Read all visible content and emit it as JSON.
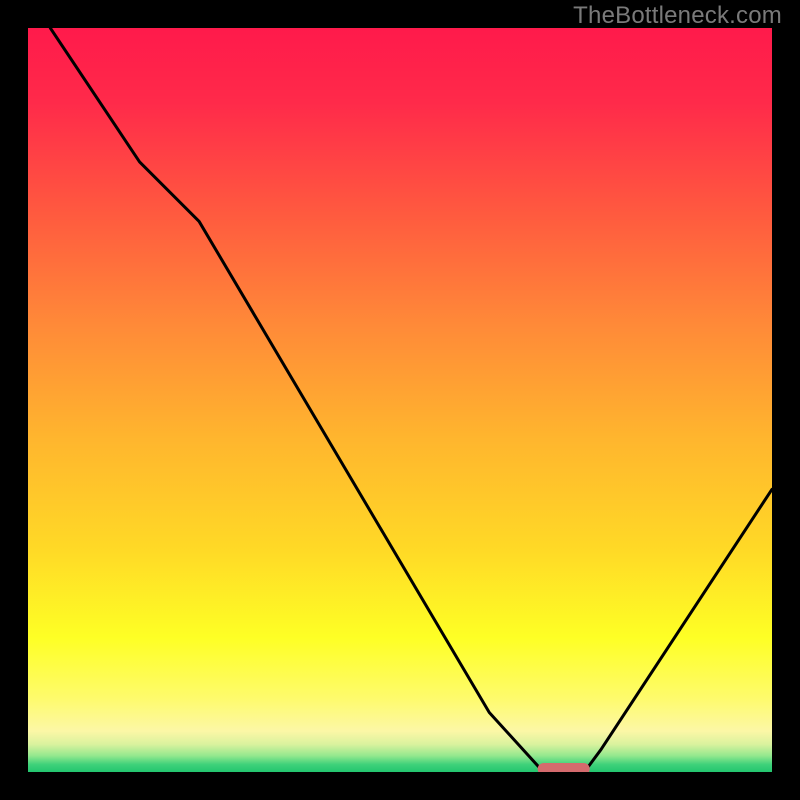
{
  "watermark": "TheBottleneck.com",
  "colors": {
    "gradient_stops": [
      {
        "offset": 0.0,
        "color": "#ff1a4b"
      },
      {
        "offset": 0.1,
        "color": "#ff2a4a"
      },
      {
        "offset": 0.25,
        "color": "#ff5a3f"
      },
      {
        "offset": 0.4,
        "color": "#ff8a38"
      },
      {
        "offset": 0.55,
        "color": "#ffb52e"
      },
      {
        "offset": 0.7,
        "color": "#ffd926"
      },
      {
        "offset": 0.82,
        "color": "#feff25"
      },
      {
        "offset": 0.9,
        "color": "#fefb6b"
      },
      {
        "offset": 0.945,
        "color": "#fcf7a6"
      },
      {
        "offset": 0.963,
        "color": "#d9f29e"
      },
      {
        "offset": 0.978,
        "color": "#94e88e"
      },
      {
        "offset": 0.99,
        "color": "#3ed17a"
      },
      {
        "offset": 1.0,
        "color": "#23c66f"
      }
    ],
    "curve": "#000000",
    "marker_fill": "#d46a6d",
    "background": "#000000"
  },
  "chart_data": {
    "type": "line",
    "title": "",
    "xlabel": "",
    "ylabel": "",
    "xlim": [
      0,
      100
    ],
    "ylim": [
      0,
      100
    ],
    "series": [
      {
        "name": "curve",
        "x": [
          3,
          15,
          23,
          62,
          69,
          75,
          77,
          100
        ],
        "values": [
          100,
          82,
          74,
          8,
          0.3,
          0.3,
          3,
          38
        ]
      }
    ],
    "marker": {
      "x_center": 72,
      "x_width": 7,
      "y": 0.4
    }
  }
}
